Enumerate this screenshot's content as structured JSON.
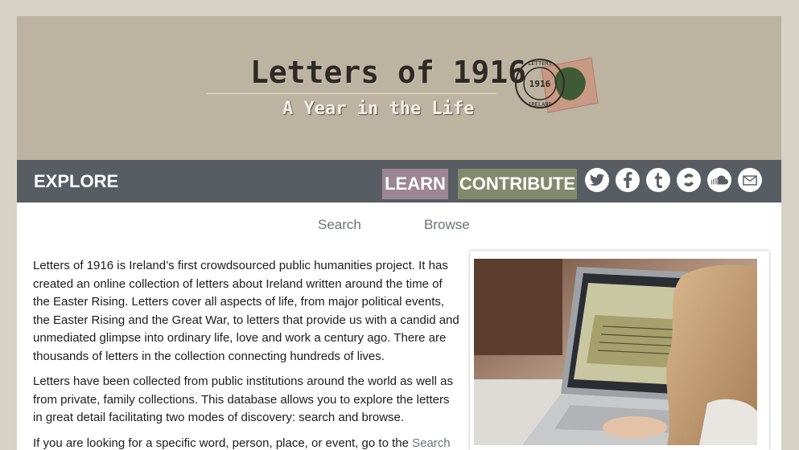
{
  "banner": {
    "title": "Letters of 1916",
    "subtitle": "A Year in the Life",
    "stamp_text_top": "LETTERS",
    "stamp_text_bottom": "IRELAND",
    "stamp_year": "1916"
  },
  "nav": {
    "explore": "EXPLORE",
    "learn": "LEARN",
    "contribute": "CONTRIBUTE",
    "social_icons": [
      "twitter-icon",
      "facebook-icon",
      "tumblr-icon",
      "website-icon",
      "soundcloud-icon",
      "email-icon"
    ],
    "colors": {
      "bar": "#585d63",
      "learn": "#9b8692",
      "contribute": "#838a6c"
    }
  },
  "tabs": {
    "search": "Search",
    "browse": "Browse"
  },
  "content": {
    "p1": "Letters of 1916 is Ireland’s first crowdsourced public humanities project. It has created an online collection of letters about Ireland written around the time of the Easter Rising. Letters cover all aspects of life, from major political events, the Easter Rising and the Great War, to letters that provide us with a candid and unmediated glimpse into ordinary life, love and work a century ago. There are thousands of letters in the collection connecting hundreds of lives.",
    "p2": "Letters have been collected from public institutions around the world as well as from private, family collections. This database allows you to explore the letters in great detail facilitating two modes of discovery: search and browse.",
    "p3_start": "If you are looking for a specific word, person, place, or event, go to the ",
    "p3_link": "Search"
  },
  "photo": {
    "subject": "person-using-laptop-transcribing-letter"
  }
}
